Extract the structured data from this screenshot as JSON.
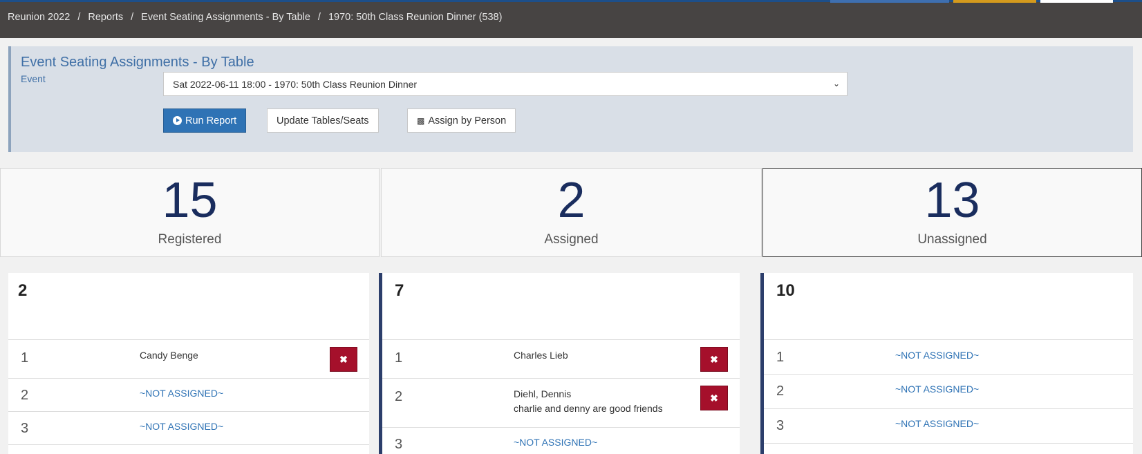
{
  "breadcrumb": [
    {
      "label": "Reunion 2022"
    },
    {
      "label": "Reports"
    },
    {
      "label": "Event Seating Assignments - By Table"
    },
    {
      "label": "1970: 50th Class Reunion Dinner (538)"
    }
  ],
  "breadcrumb_separator": "/",
  "panel": {
    "title": "Event Seating Assignments - By Table",
    "event_label": "Event",
    "event_selected": "Sat 2022-06-11 18:00 - 1970: 50th Class Reunion Dinner",
    "run_label": "Run Report",
    "update_label": "Update Tables/Seats",
    "assign_label": "Assign by Person"
  },
  "stats": [
    {
      "value": "15",
      "label": "Registered"
    },
    {
      "value": "2",
      "label": "Assigned"
    },
    {
      "value": "13",
      "label": "Unassigned"
    }
  ],
  "tables": [
    {
      "number": "2",
      "seats": [
        {
          "seat": "1",
          "name": "Candy Benge",
          "note": "",
          "assigned": true
        },
        {
          "seat": "2",
          "name": "~NOT ASSIGNED~",
          "note": "",
          "assigned": false
        },
        {
          "seat": "3",
          "name": "~NOT ASSIGNED~",
          "note": "",
          "assigned": false
        }
      ]
    },
    {
      "number": "7",
      "seats": [
        {
          "seat": "1",
          "name": "Charles Lieb",
          "note": "",
          "assigned": true
        },
        {
          "seat": "2",
          "name": "Diehl, Dennis",
          "note": "charlie and denny are good friends",
          "assigned": true
        },
        {
          "seat": "3",
          "name": "~NOT ASSIGNED~",
          "note": "",
          "assigned": false
        }
      ]
    },
    {
      "number": "10",
      "seats": [
        {
          "seat": "1",
          "name": "~NOT ASSIGNED~",
          "note": "",
          "assigned": false
        },
        {
          "seat": "2",
          "name": "~NOT ASSIGNED~",
          "note": "",
          "assigned": false
        },
        {
          "seat": "3",
          "name": "~NOT ASSIGNED~",
          "note": "",
          "assigned": false
        }
      ]
    }
  ],
  "icons": {
    "remove": "✖",
    "run": "play-circle-icon",
    "assign": "sitemap-icon",
    "chevron": "chevron-down-icon"
  },
  "colors": {
    "topbar": "#474443",
    "primary": "#2f73b5",
    "danger": "#a5102b",
    "stat_number": "#1a2d5e",
    "panel_bg": "#d9dfe7"
  }
}
